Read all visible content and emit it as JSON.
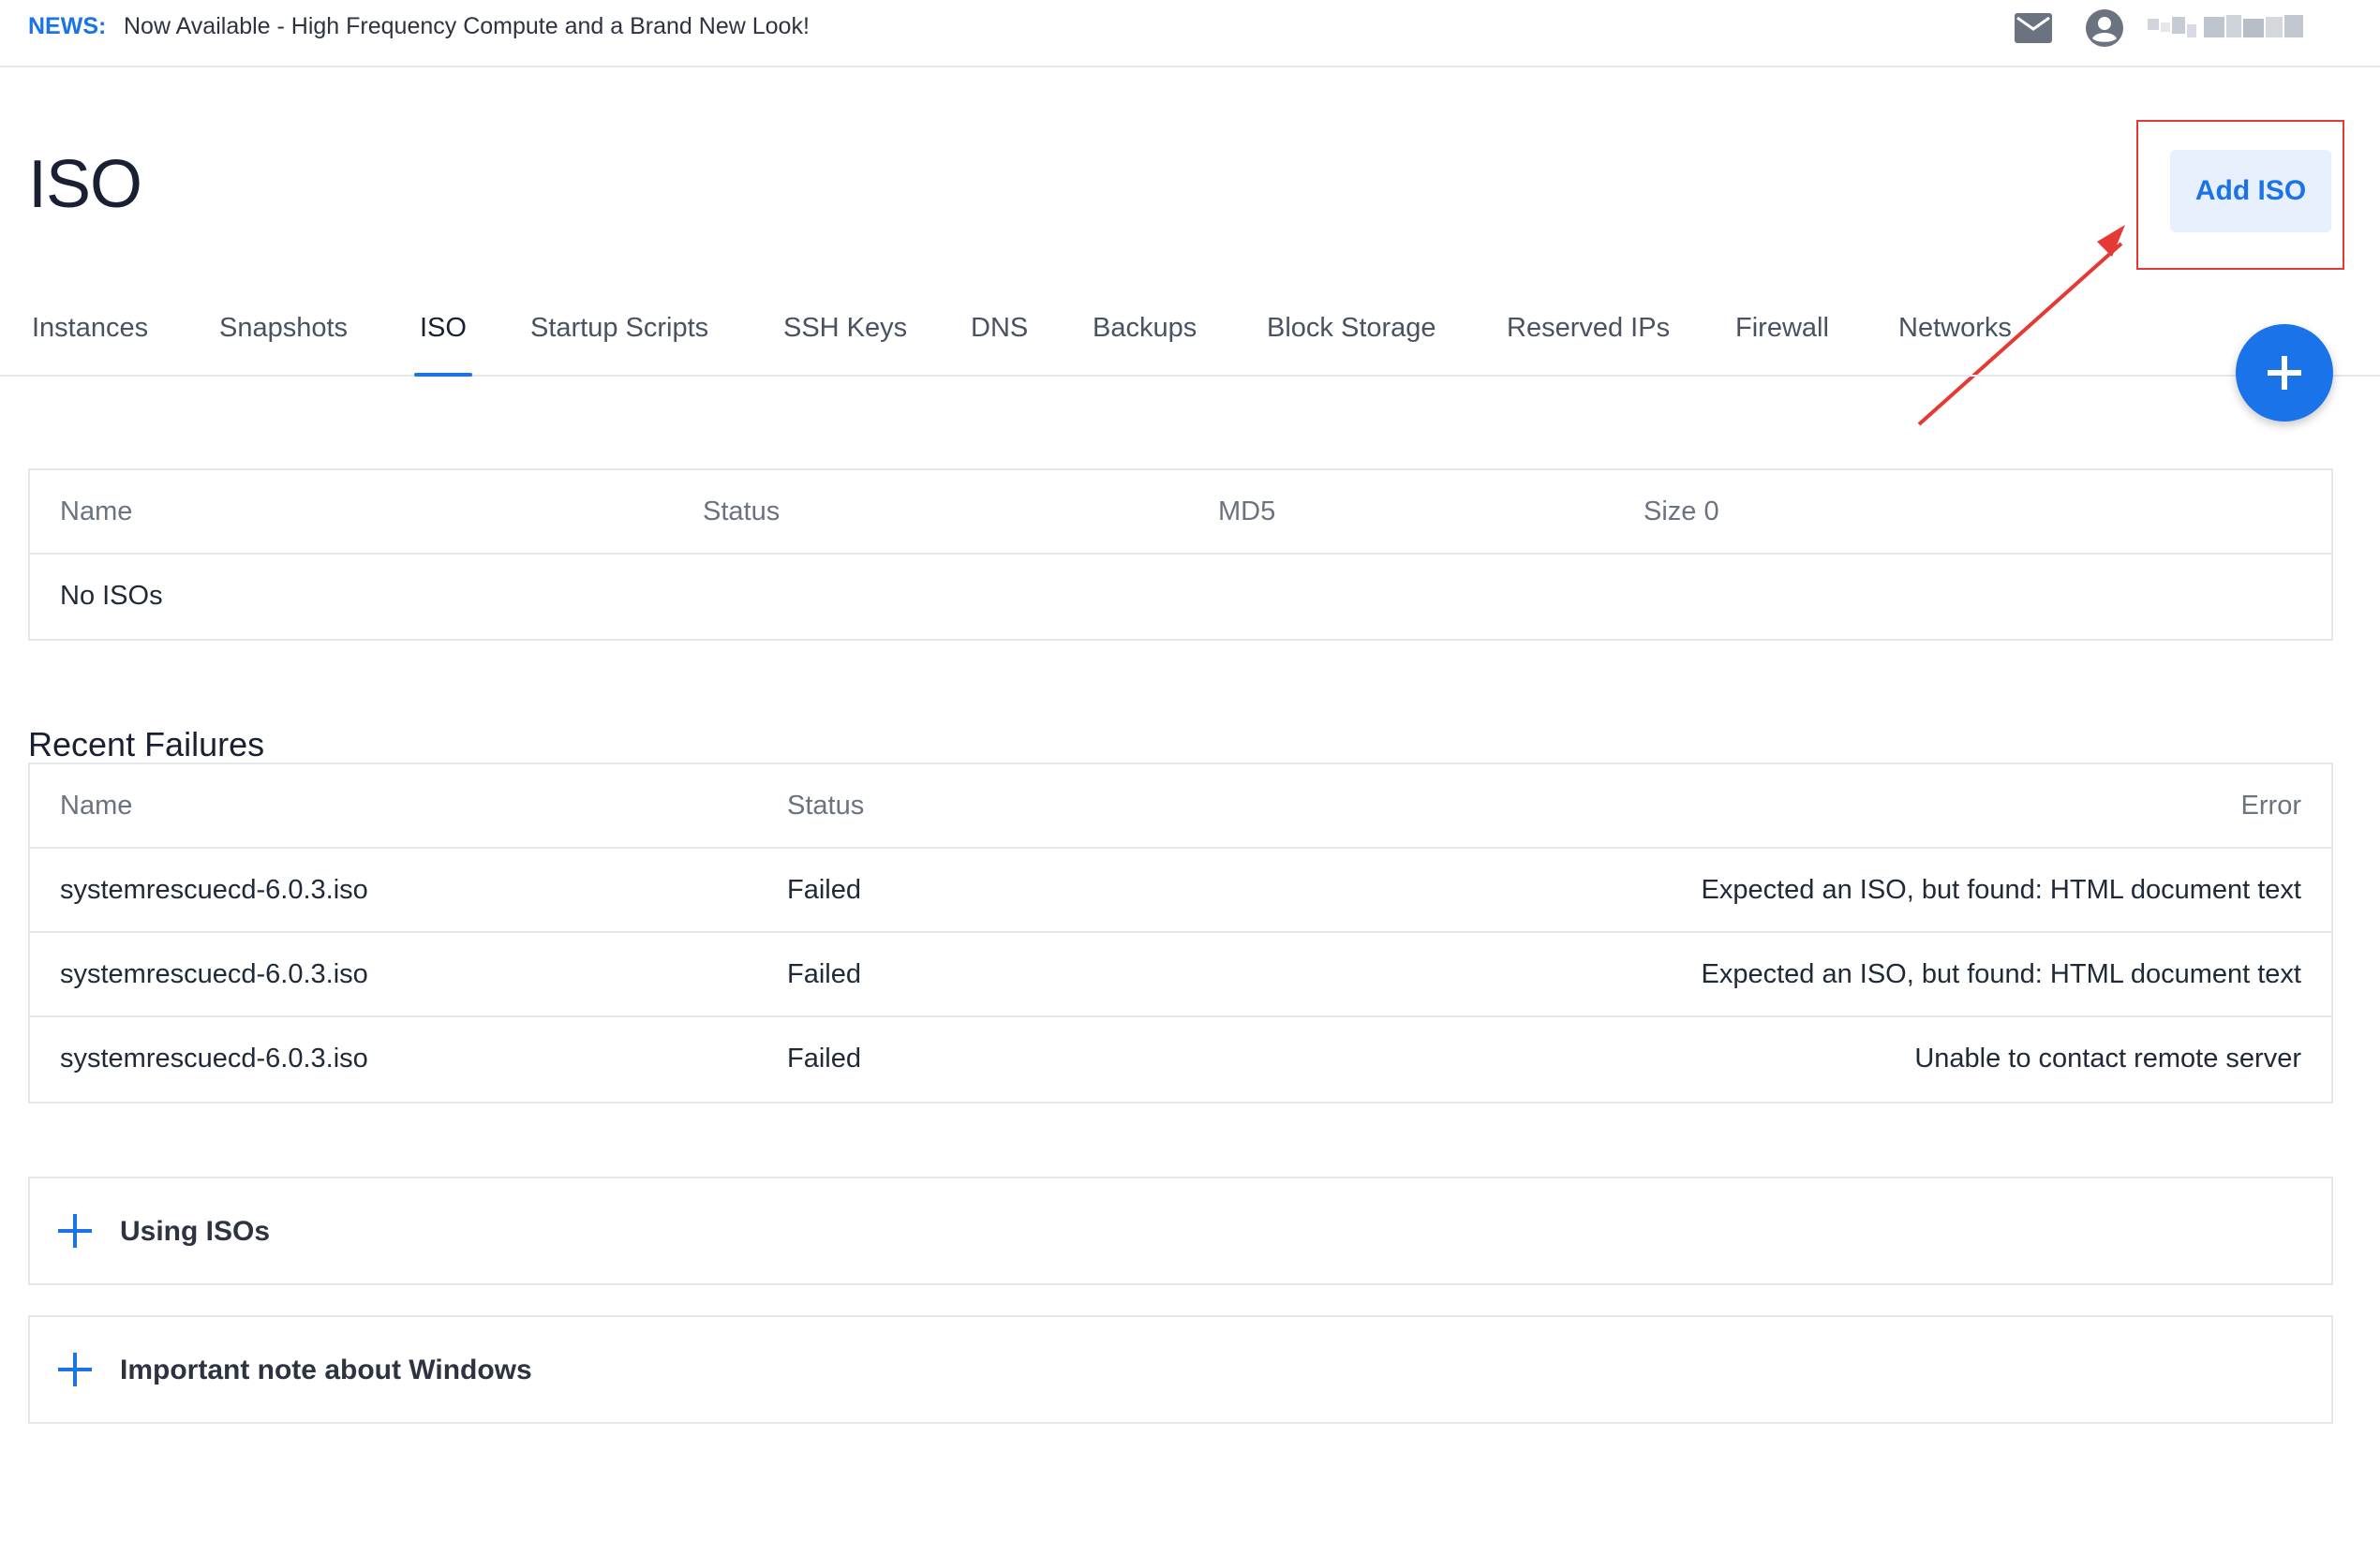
{
  "news": {
    "label": "NEWS:",
    "text": "Now Available - High Frequency Compute and a Brand New Look!"
  },
  "header": {
    "icons": [
      "mail-icon",
      "user-icon"
    ]
  },
  "page": {
    "title": "ISO",
    "add_button": "Add ISO"
  },
  "tabs": [
    {
      "label": "Instances"
    },
    {
      "label": "Snapshots"
    },
    {
      "label": "ISO",
      "active": true
    },
    {
      "label": "Startup Scripts"
    },
    {
      "label": "SSH Keys"
    },
    {
      "label": "DNS"
    },
    {
      "label": "Backups"
    },
    {
      "label": "Block Storage"
    },
    {
      "label": "Reserved IPs"
    },
    {
      "label": "Firewall"
    },
    {
      "label": "Networks"
    }
  ],
  "iso_table": {
    "headers": [
      "Name",
      "Status",
      "MD5",
      "Size 0"
    ],
    "empty_text": "No ISOs"
  },
  "failures": {
    "title": "Recent Failures",
    "headers": [
      "Name",
      "Status",
      "Error"
    ],
    "rows": [
      {
        "name": "systemrescuecd-6.0.3.iso",
        "status": "Failed",
        "error": "Expected an ISO, but found: HTML document text"
      },
      {
        "name": "systemrescuecd-6.0.3.iso",
        "status": "Failed",
        "error": "Expected an ISO, but found: HTML document text"
      },
      {
        "name": "systemrescuecd-6.0.3.iso",
        "status": "Failed",
        "error": "Unable to contact remote server"
      }
    ]
  },
  "accordions": [
    {
      "label": "Using ISOs"
    },
    {
      "label": "Important note about Windows"
    }
  ],
  "colors": {
    "accent": "#1a73e8",
    "highlight": "#e53935",
    "border": "#e4e7ec"
  }
}
